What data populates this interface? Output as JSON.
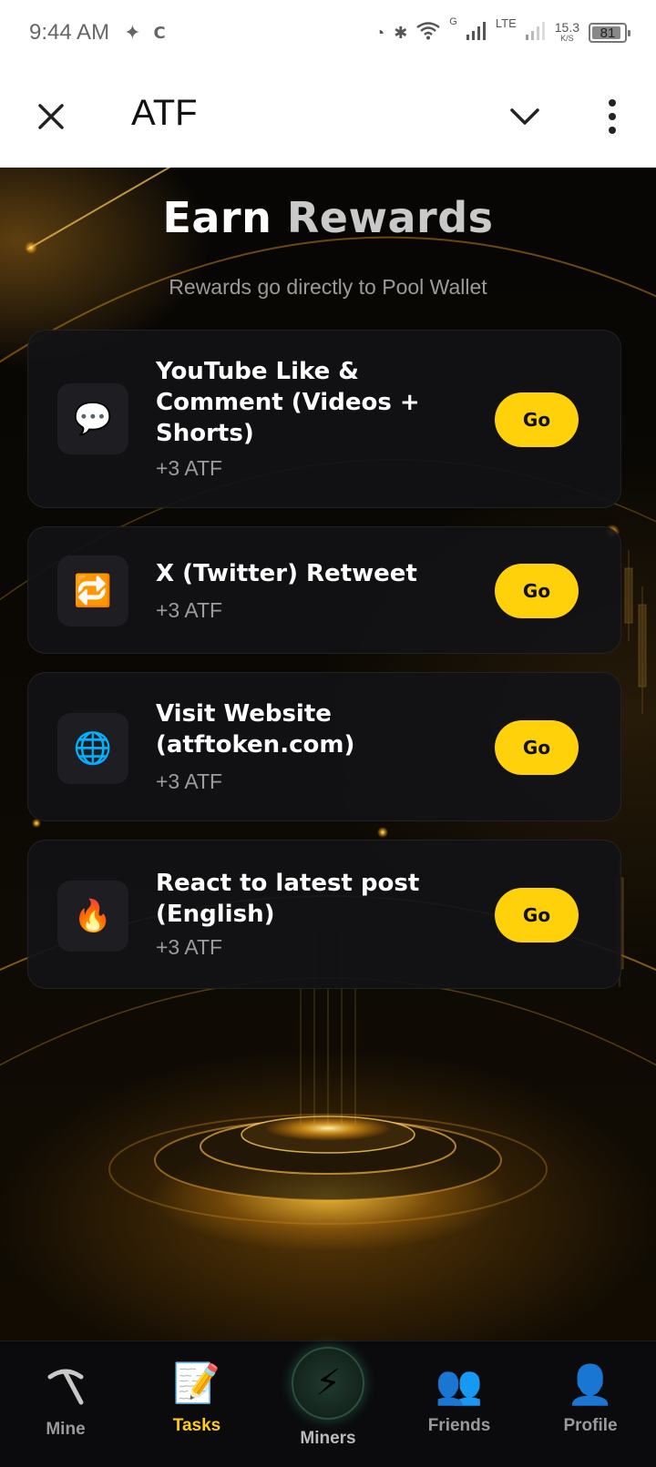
{
  "status_bar": {
    "time": "9:44 AM",
    "network": "G",
    "lte": "LTE",
    "speed_value": "15.3",
    "speed_unit": "K/S",
    "battery": "81"
  },
  "app_bar": {
    "title": "ATF"
  },
  "main": {
    "title_part1": "Earn",
    "title_part2": "Rewards",
    "subtitle": "Rewards go directly to Pool Wallet",
    "tasks": [
      {
        "icon": "💬",
        "title": "YouTube Like & Comment (Videos + Shorts)",
        "reward": "+3 ATF",
        "button": "Go"
      },
      {
        "icon": "🔁",
        "title": "X (Twitter) Retweet",
        "reward": "+3 ATF",
        "button": "Go"
      },
      {
        "icon": "🌐",
        "title": "Visit Website (atftoken.com)",
        "reward": "+3 ATF",
        "button": "Go"
      },
      {
        "icon": "🔥",
        "title": "React to latest post (English)",
        "reward": "+3 ATF",
        "button": "Go"
      }
    ]
  },
  "bottom_nav": {
    "items": [
      {
        "label": "Mine",
        "icon": "⛏"
      },
      {
        "label": "Tasks",
        "icon": "📝"
      },
      {
        "label": "Miners",
        "icon": "⚡"
      },
      {
        "label": "Friends",
        "icon": "👥"
      },
      {
        "label": "Profile",
        "icon": "👤"
      }
    ],
    "active": "Tasks"
  },
  "colors": {
    "accent": "#ffd10a",
    "background": "#000000",
    "card": "#121216"
  }
}
